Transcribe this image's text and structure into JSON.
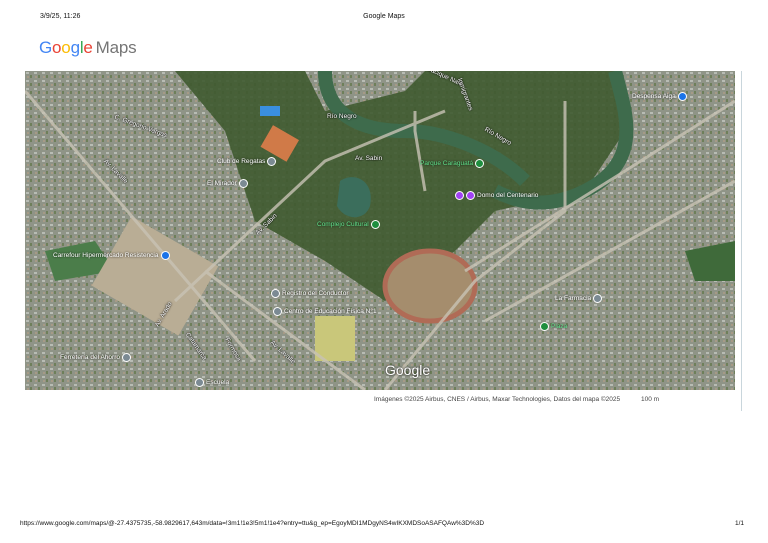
{
  "print_header": {
    "date": "3/9/25, 11:26",
    "title": "Google Maps"
  },
  "logo": {
    "google": "Google",
    "maps": "Maps"
  },
  "map": {
    "watermark": "Google",
    "streets": [
      "Río Negro",
      "Río Negro",
      "Av. Sabin",
      "Av. Sabin",
      "Av. Lavalle",
      "Av. Lavalle",
      "Cacique Nalé",
      "Inmigrantes",
      "Av. Arado",
      "Catamarca",
      "Formosa",
      "C. Gregorio Vargas"
    ],
    "pois": [
      {
        "label": "Despensa Aiga",
        "color": "#1a73e8"
      },
      {
        "label": "Carrefour Hipermercado Resistencia",
        "color": "#1a73e8"
      },
      {
        "label": "Club de Regatas",
        "color": "#7b8a93"
      },
      {
        "label": "El Mirador",
        "color": "#7b8a93"
      },
      {
        "label": "Parque Caraguatá",
        "color": "#1e8e3e"
      },
      {
        "label": "Domo del Centenario",
        "color": "#a142f4"
      },
      {
        "label": "Complejo Cultural",
        "color": "#1e8e3e"
      },
      {
        "label": "Registro del Conductor",
        "color": "#7b8a93"
      },
      {
        "label": "Centro de Educación Física N°1",
        "color": "#7b8a93"
      },
      {
        "label": "Ferretería del Ahorro",
        "color": "#7b8a93"
      },
      {
        "label": "Escuela",
        "color": "#7b8a93"
      },
      {
        "label": "Plaza",
        "color": "#1e8e3e"
      },
      {
        "label": "La Farmacia",
        "color": "#7b8a93"
      }
    ]
  },
  "attribution": "Imágenes ©2025 Airbus, CNES / Airbus, Maxar Technologies, Datos del mapa ©2025",
  "scale": "100 m",
  "footer": {
    "url": "https://www.google.com/maps/@-27.4375735,-58.9829617,643m/data=!3m1!1e3!5m1!1e4?entry=ttu&g_ep=EgoyMDI1MDgyNS4wIKXMDSoASAFQAw%3D%3D",
    "page": "1/1"
  }
}
